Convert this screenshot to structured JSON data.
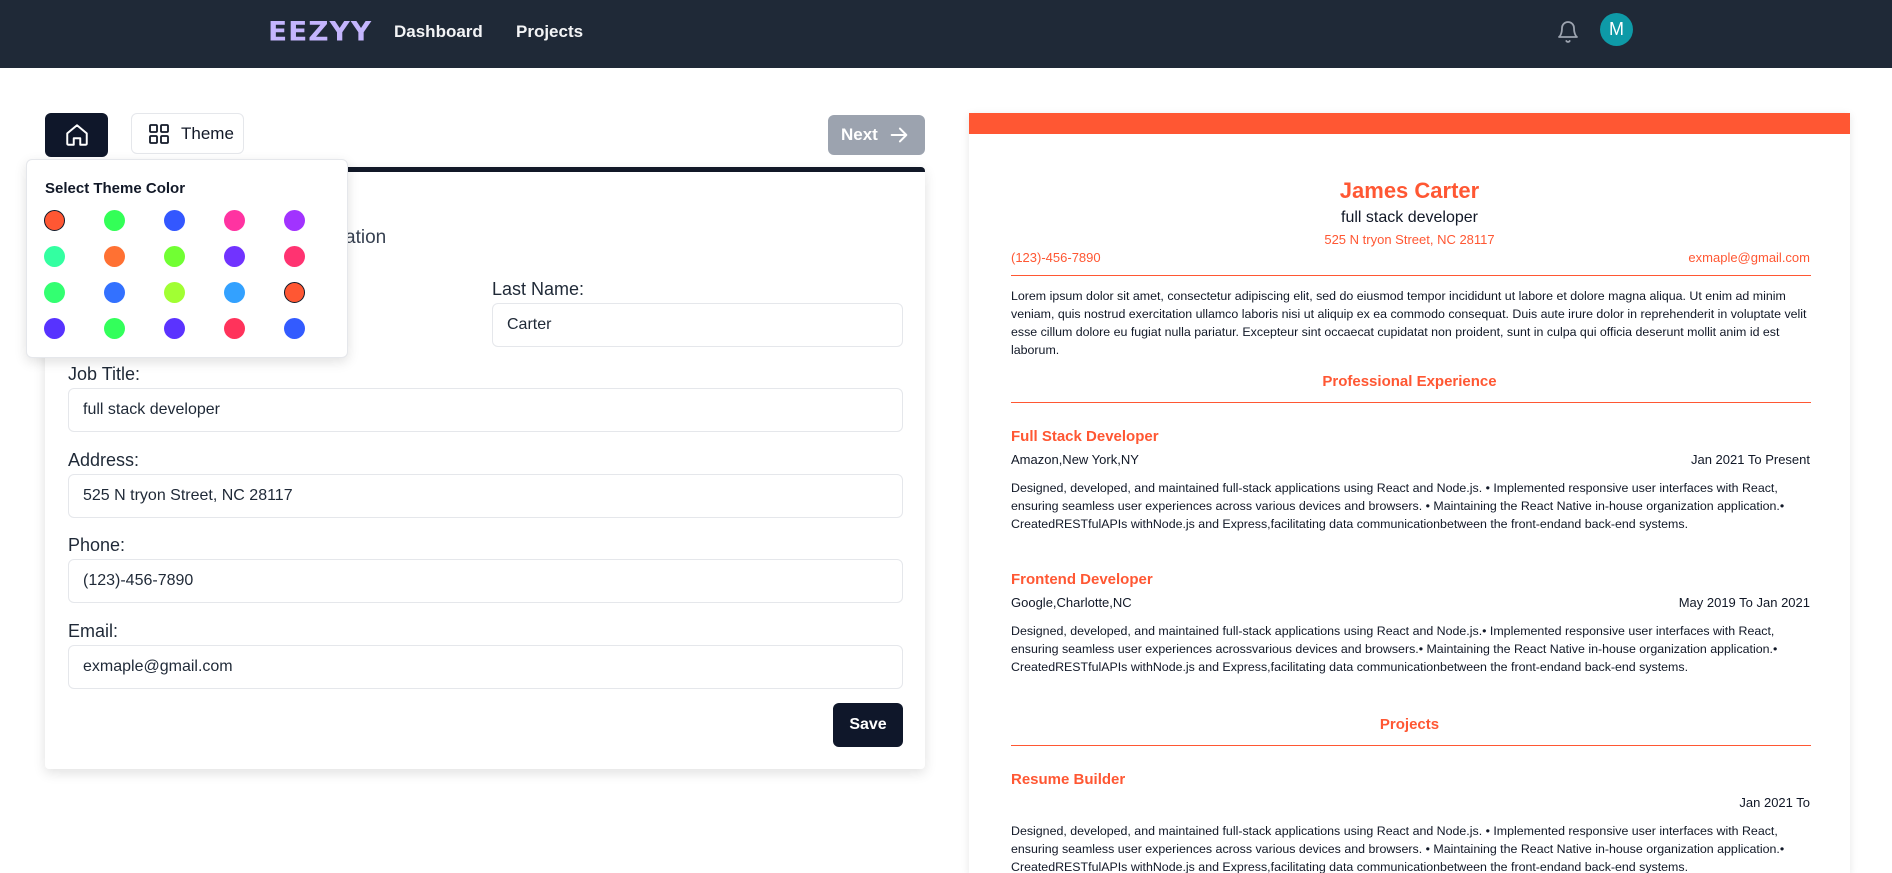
{
  "nav": {
    "logo": "EEZYY",
    "links": [
      "Dashboard",
      "Projects"
    ],
    "avatar_initial": "M"
  },
  "toolbar": {
    "theme_label": "Theme",
    "next_label": "Next"
  },
  "theme_popover": {
    "title": "Select Theme Color",
    "colors": [
      "#ff5733",
      "#33ff57",
      "#3357ff",
      "#ff33a1",
      "#a133ff",
      "#33ffa1",
      "#ff7133",
      "#71ff33",
      "#7133ff",
      "#ff3371",
      "#33ff71",
      "#3371ff",
      "#a1ff33",
      "#33a1ff",
      "#ff5733",
      "#5733ff",
      "#33ff5b",
      "#5b33ff",
      "#ff335b",
      "#335bff"
    ],
    "selected_index": 0
  },
  "form": {
    "subtitle_partial": "ation",
    "last_name_label": "Last Name:",
    "last_name_value": "Carter",
    "job_title_label": "Job Title:",
    "job_title_value": "full stack developer",
    "address_label": "Address:",
    "address_value": "525 N tryon Street, NC 28117",
    "phone_label": "Phone:",
    "phone_value": "(123)-456-7890",
    "email_label": "Email:",
    "email_value": "exmaple@gmail.com",
    "save_label": "Save"
  },
  "resume": {
    "accent_color": "#ff5733",
    "name": "James Carter",
    "job_title": "full stack developer",
    "address": "525 N tryon Street, NC 28117",
    "phone": "(123)-456-7890",
    "email": "exmaple@gmail.com",
    "summary": "Lorem ipsum dolor sit amet, consectetur adipiscing elit, sed do eiusmod tempor incididunt ut labore et dolore magna aliqua. Ut enim ad minim veniam, quis nostrud exercitation ullamco laboris nisi ut aliquip ex ea commodo consequat. Duis aute irure dolor in reprehenderit in voluptate velit esse cillum dolore eu fugiat nulla pariatur. Excepteur sint occaecat cupidatat non proident, sunt in culpa qui officia deserunt mollit anim id est laborum.",
    "experience_heading": "Professional Experience",
    "experience": [
      {
        "title": "Full Stack Developer",
        "company": "Amazon,New York,NY",
        "dates": "Jan 2021 To Present",
        "description": "Designed, developed, and maintained full-stack applications using React and Node.js. • Implemented responsive user interfaces with React, ensuring seamless user experiences across various devices and browsers. • Maintaining the React Native in-house organization application.• CreatedRESTfulAPIs withNode.js and Express,facilitating data communicationbetween the front-endand back-end systems."
      },
      {
        "title": "Frontend Developer",
        "company": "Google,Charlotte,NC",
        "dates": "May 2019 To Jan 2021",
        "description": "Designed, developed, and maintained full-stack applications using React and Node.js.• Implemented responsive user interfaces with React, ensuring seamless user experiences acrossvarious devices and browsers.• Maintaining the React Native in-house organization application.• CreatedRESTfulAPIs withNode.js and Express,facilitating data communicationbetween the front-endand back-end systems."
      }
    ],
    "projects_heading": "Projects",
    "projects": [
      {
        "title": "Resume Builder",
        "dates": "Jan 2021 To",
        "description": "Designed, developed, and maintained full-stack applications using React and Node.js. • Implemented responsive user interfaces with React, ensuring seamless user experiences across various devices and browsers. • Maintaining the React Native in-house organization application.• CreatedRESTfulAPIs withNode.js and Express,facilitating data communicationbetween the front-endand back-end systems."
      }
    ]
  }
}
